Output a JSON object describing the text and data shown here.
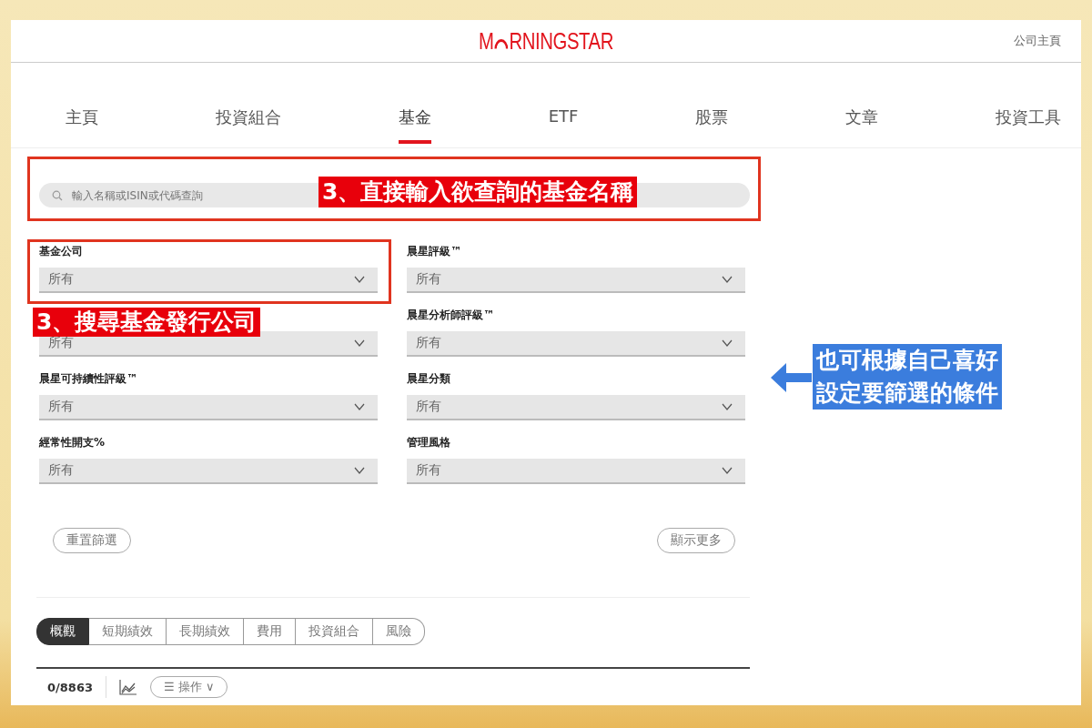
{
  "header": {
    "logo_start": "M",
    "logo_end": "RNINGSTAR",
    "link": "公司主頁"
  },
  "nav": [
    {
      "label": "主頁",
      "selected": false
    },
    {
      "label": "投資組合",
      "selected": false
    },
    {
      "label": "基金",
      "selected": true
    },
    {
      "label": "ETF",
      "selected": false
    },
    {
      "label": "股票",
      "selected": false
    },
    {
      "label": "文章",
      "selected": false
    },
    {
      "label": "投資工具",
      "selected": false
    }
  ],
  "search": {
    "placeholder": "輸入名稱或ISIN或代碼查詢"
  },
  "filters": [
    {
      "label": "基金公司",
      "value": "所有"
    },
    {
      "label": "晨星評級™",
      "value": "所有"
    },
    {
      "value": "所有"
    },
    {
      "label": "晨星分析師評級™",
      "value": "所有"
    },
    {
      "label": "晨星可持續性評級™",
      "value": "所有"
    },
    {
      "label": "晨星分類",
      "value": "所有"
    },
    {
      "label": "經常性開支%",
      "value": "所有"
    },
    {
      "label": "管理風格",
      "value": "所有"
    }
  ],
  "buttons": {
    "reset": "重置篩選",
    "more": "顯示更多"
  },
  "view_tabs": [
    {
      "label": "概觀",
      "selected": true
    },
    {
      "label": "短期績效",
      "selected": false
    },
    {
      "label": "長期績效",
      "selected": false
    },
    {
      "label": "費用",
      "selected": false
    },
    {
      "label": "投資組合",
      "selected": false
    },
    {
      "label": "風險",
      "selected": false
    }
  ],
  "results": {
    "count": "0/8863",
    "actions": "操作",
    "actions_icon": "☰",
    "caret": "∨"
  },
  "annotations": {
    "search": "3、直接輸入欲查詢的基金名稱",
    "company": "3、搜尋基金發行公司",
    "callout": [
      "也可根據自己喜好",
      "設定要篩選的條件"
    ]
  }
}
